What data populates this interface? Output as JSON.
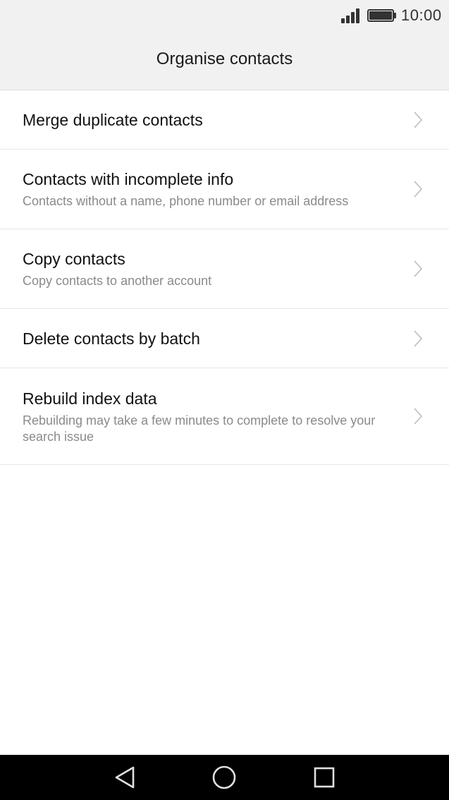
{
  "status_bar": {
    "time": "10:00",
    "signal_icon": "signal-icon",
    "battery_icon": "battery-icon",
    "battery_level": 1.0,
    "signal_level": 4
  },
  "header": {
    "title": "Organise contacts"
  },
  "menu": {
    "items": [
      {
        "title": "Merge duplicate contacts"
      },
      {
        "title": "Contacts with incomplete info",
        "subtitle": "Contacts without a name, phone number or email address"
      },
      {
        "title": "Copy contacts",
        "subtitle": "Copy contacts to another account"
      },
      {
        "title": "Delete contacts by batch"
      },
      {
        "title": "Rebuild index data",
        "subtitle": "Rebuilding may take a few minutes to complete to resolve your search issue"
      }
    ],
    "chevron_icon": "chevron-right-icon"
  },
  "nav_bar": {
    "back_icon": "back-triangle-icon",
    "home_icon": "home-circle-icon",
    "recents_icon": "recents-square-icon"
  },
  "colors": {
    "header_bg": "#f1f1f1",
    "page_bg": "#ffffff",
    "nav_bg": "#000000",
    "title_text": "#111111",
    "subtitle_text": "#8a8a8a",
    "divider": "#e6e6e6"
  }
}
